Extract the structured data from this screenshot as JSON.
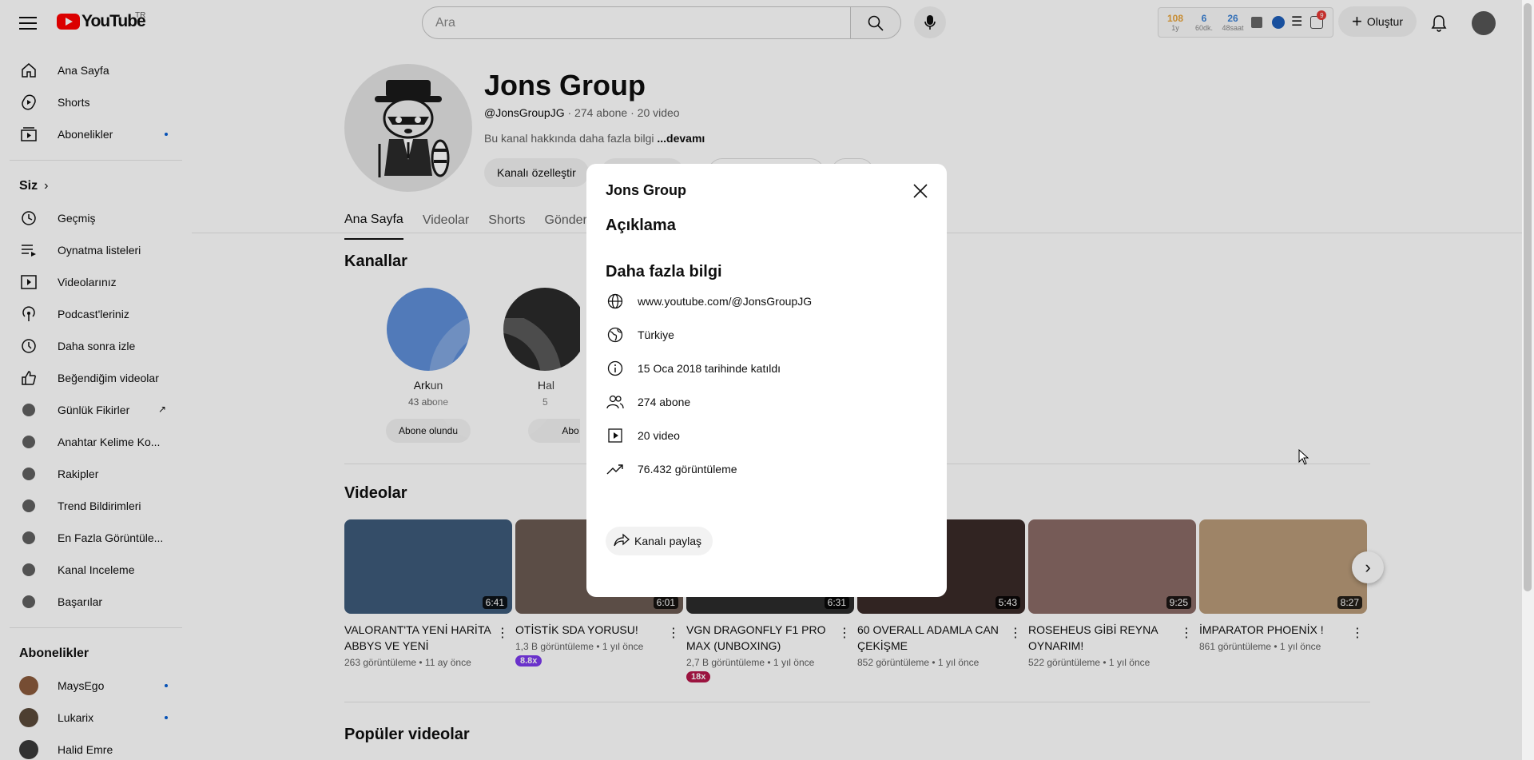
{
  "header": {
    "logo_text": "YouTube",
    "country": "TR",
    "search_placeholder": "Ara",
    "extension": {
      "stat1_value": "108",
      "stat1_sub": "1y",
      "stat2_value": "6",
      "stat2_sub": "60dk.",
      "stat3_value": "26",
      "stat3_sub": "48saat",
      "notif_count": "9"
    },
    "create_label": "Oluştur"
  },
  "sidebar": {
    "main_items": [
      {
        "label": "Ana Sayfa",
        "icon": "home-icon"
      },
      {
        "label": "Shorts",
        "icon": "shorts-icon"
      },
      {
        "label": "Abonelikler",
        "icon": "subscriptions-icon"
      }
    ],
    "you_label": "Siz",
    "you_items": [
      {
        "label": "Geçmiş",
        "icon": "history-icon"
      },
      {
        "label": "Oynatma listeleri",
        "icon": "playlist-icon"
      },
      {
        "label": "Videolarınız",
        "icon": "your-videos-icon"
      },
      {
        "label": "Podcast'leriniz",
        "icon": "podcast-icon"
      },
      {
        "label": "Daha sonra izle",
        "icon": "watch-later-icon"
      },
      {
        "label": "Beğendiğim videolar",
        "icon": "like-icon"
      },
      {
        "label": "Günlük Fikirler",
        "icon": "extension-icon"
      },
      {
        "label": "Anahtar Kelime Ko...",
        "icon": "extension-icon"
      },
      {
        "label": "Rakipler",
        "icon": "extension-icon"
      },
      {
        "label": "Trend Bildirimleri",
        "icon": "extension-icon"
      },
      {
        "label": "En Fazla Görüntüle...",
        "icon": "extension-icon"
      },
      {
        "label": "Kanal Inceleme",
        "icon": "extension-icon"
      },
      {
        "label": "Başarılar",
        "icon": "extension-icon"
      }
    ],
    "subs_label": "Abonelikler",
    "subs": [
      {
        "label": "MaysEgo",
        "color": "#8a5a3c"
      },
      {
        "label": "Lukarix",
        "color": "#5a4a3a"
      },
      {
        "label": "Halid Emre",
        "color": "#3a3a3a"
      }
    ]
  },
  "channel": {
    "title": "Jons Group",
    "handle": "@JonsGroupJG",
    "meta": " · 274 abone · 20 video",
    "desc": "Bu kanal hakkında daha fazla bilgi ",
    "desc_more": "...devamı",
    "customize_label": "Kanalı özelleştir",
    "tabs": [
      "Ana Sayfa",
      "Videolar",
      "Shorts",
      "Gönder"
    ]
  },
  "channels_section": {
    "title": "Kanallar",
    "items": [
      {
        "name": "Arkun",
        "subs": "43 abone",
        "button": "Abone olundu",
        "color": "#5f8fd8"
      },
      {
        "name": "Hal",
        "subs": "5",
        "button": "Abo",
        "color": "#2a2a2a"
      }
    ]
  },
  "videos_section": {
    "title": "Videolar",
    "videos": [
      {
        "title": "VALORANT'TA YENİ HARİTA ABBYS VE YENİ KARAKTER...",
        "meta": "263 görüntüleme • 11 ay önce",
        "duration": "6:41",
        "color": "#3d5a7a",
        "badge": ""
      },
      {
        "title": "OTİSTİK SDA YORUSU!",
        "meta": "1,3 B görüntüleme • 1 yıl önce",
        "duration": "6:01",
        "color": "#6a5a52",
        "badge": "8.8x",
        "badge_color": "#7c3aed"
      },
      {
        "title": "VGN DRAGONFLY F1 PRO MAX (UNBOXING)",
        "meta": "2,7 B görüntüleme • 1 yıl önce",
        "duration": "6:31",
        "color": "#2c2c2c",
        "badge": "18x",
        "badge_color": "#b5174a"
      },
      {
        "title": "60 OVERALL ADAMLA CAN ÇEKİŞME",
        "meta": "852 görüntüleme • 1 yıl önce",
        "duration": "5:43",
        "color": "#3a2a28",
        "badge": ""
      },
      {
        "title": "ROSEHEUS GİBİ REYNA OYNARIM!",
        "meta": "522 görüntüleme • 1 yıl önce",
        "duration": "9:25",
        "color": "#8a6a66",
        "badge": ""
      },
      {
        "title": "İMPARATOR PHOENİX !",
        "meta": "861 görüntüleme • 1 yıl önce",
        "duration": "8:27",
        "color": "#b89a78",
        "badge": ""
      }
    ]
  },
  "popular_section": {
    "title": "Popüler videolar"
  },
  "modal": {
    "title": "Jons Group",
    "description_heading": "Açıklama",
    "more_info_heading": "Daha fazla bilgi",
    "rows": [
      {
        "icon": "globe-icon",
        "text": "www.youtube.com/@JonsGroupJG"
      },
      {
        "icon": "location-globe-icon",
        "text": "Türkiye"
      },
      {
        "icon": "info-icon",
        "text": "15 Oca 2018 tarihinde katıldı"
      },
      {
        "icon": "people-icon",
        "text": "274 abone"
      },
      {
        "icon": "video-icon",
        "text": "20 video"
      },
      {
        "icon": "trending-icon",
        "text": "76.432 görüntüleme"
      }
    ],
    "share_label": "Kanalı paylaş"
  },
  "colors": {
    "accent_red": "#ff0000",
    "link_blue": "#065fd4",
    "overlay": "rgba(0,0,0,0.14)"
  }
}
